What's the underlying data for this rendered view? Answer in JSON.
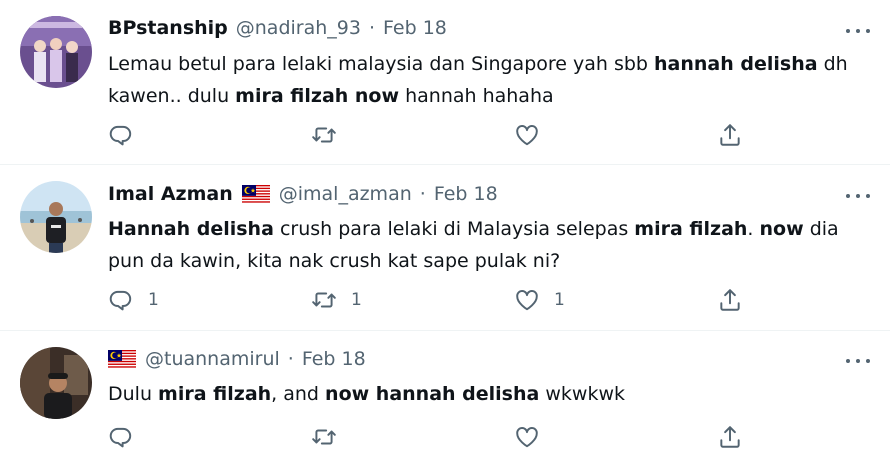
{
  "tweets": [
    {
      "name": "BPstanship",
      "handle": "@nadirah_93",
      "separator": "·",
      "date": "Feb 18",
      "text_segments": [
        {
          "text": "Lemau betul para lelaki malaysia dan Singapore yah sbb ",
          "bold": false
        },
        {
          "text": "hannah delisha",
          "bold": true
        },
        {
          "text": " dh kawen.. dulu ",
          "bold": false
        },
        {
          "text": "mira filzah now",
          "bold": true
        },
        {
          "text": " hannah hahaha",
          "bold": false
        }
      ],
      "reply_count": "",
      "retweet_count": "",
      "like_count": ""
    },
    {
      "name": "Imal Azman",
      "handle": "@imal_azman",
      "separator": "·",
      "date": "Feb 18",
      "text_segments": [
        {
          "text": "Hannah delisha",
          "bold": true
        },
        {
          "text": " crush para lelaki di Malaysia selepas ",
          "bold": false
        },
        {
          "text": "mira filzah",
          "bold": true
        },
        {
          "text": ". ",
          "bold": false
        },
        {
          "text": "now",
          "bold": true
        },
        {
          "text": " dia pun da kawin, kita nak crush kat sape pulak ni?",
          "bold": false
        }
      ],
      "reply_count": "1",
      "retweet_count": "1",
      "like_count": "1"
    },
    {
      "name": "",
      "handle": "@tuannamirul",
      "separator": "·",
      "date": "Feb 18",
      "text_segments": [
        {
          "text": "Dulu ",
          "bold": false
        },
        {
          "text": "mira filzah",
          "bold": true
        },
        {
          "text": ", and ",
          "bold": false
        },
        {
          "text": "now hannah delisha",
          "bold": true
        },
        {
          "text": " wkwkwk",
          "bold": false
        }
      ],
      "reply_count": "",
      "retweet_count": "",
      "like_count": ""
    }
  ],
  "icons": {
    "reply": "reply-icon",
    "retweet": "retweet-icon",
    "like": "like-icon",
    "share": "share-icon",
    "more": "more-icon",
    "flag": "malaysia-flag-icon"
  },
  "colors": {
    "text": "#0f1419",
    "secondary": "#536471",
    "divider": "#eff3f4"
  }
}
